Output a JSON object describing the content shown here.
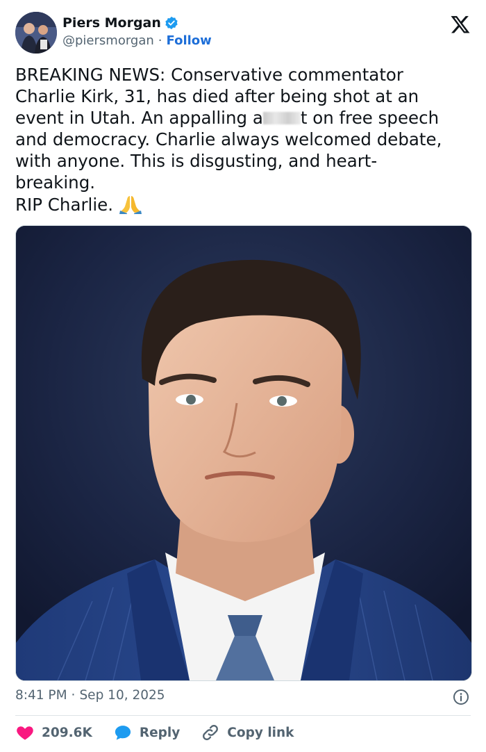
{
  "author": {
    "name": "Piers Morgan",
    "handle": "@piersmorgan",
    "follow_label": "Follow",
    "verified": true
  },
  "brand_icon": "x-logo-icon",
  "tweet": {
    "text_part1": "BREAKING NEWS: Conservative commentator\nCharlie Kirk, 31, has died after being shot at an\nevent in Utah. An appalling a",
    "text_part2": "t on free speech\nand democracy. Charlie always welcomed debate,\nwith anyone. This is disgusting, and heart-\nbreaking.\nRIP Charlie. ",
    "emoji": "folded-hands-icon"
  },
  "meta": {
    "time": "8:41 PM",
    "separator": "·",
    "date": "Sep 10, 2025"
  },
  "actions": {
    "like_count": "209.6K",
    "reply_label": "Reply",
    "copy_link_label": "Copy link"
  },
  "colors": {
    "accent": "#1d6ed8",
    "like": "#f91880",
    "reply": "#1d9bf0",
    "muted": "#536471",
    "text": "#0f1419"
  }
}
